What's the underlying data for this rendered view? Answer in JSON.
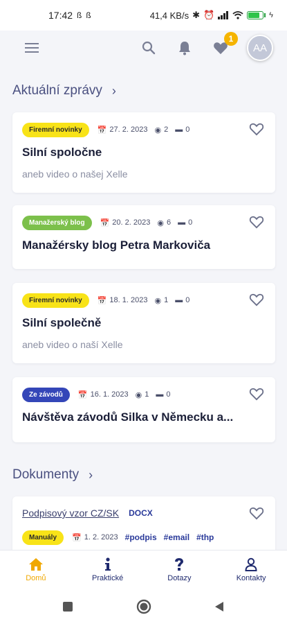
{
  "status_bar": {
    "time": "17:42",
    "left_icons": [
      "sync-icon",
      "sync-icon"
    ],
    "net_speed": "41,4 KB/s",
    "battery_percent": 80
  },
  "header": {
    "favorites_count": "1",
    "avatar_initials": "AA"
  },
  "news": {
    "title": "Aktuální zprávy",
    "items": [
      {
        "tag": "Firemní novinky",
        "tag_color": "#f8e318",
        "date": "27. 2. 2023",
        "views": "2",
        "comments": "0",
        "title": "Silní spoločne",
        "subtitle": "aneb video o našej Xelle"
      },
      {
        "tag": "Manažerský blog",
        "tag_color": "#7cc04b",
        "date": "20. 2. 2023",
        "views": "6",
        "comments": "0",
        "title": "Manažérsky blog Petra Markoviča",
        "subtitle": ""
      },
      {
        "tag": "Firemní novinky",
        "tag_color": "#f8e318",
        "date": "18. 1. 2023",
        "views": "1",
        "comments": "0",
        "title": "Silní společně",
        "subtitle": "aneb video o naší Xelle"
      },
      {
        "tag": "Ze závodů",
        "tag_color": "#3446b8",
        "date": "16. 1. 2023",
        "views": "1",
        "comments": "0",
        "title": "Návštěva závodů Silka v Německu a...",
        "subtitle": ""
      }
    ]
  },
  "documents": {
    "title": "Dokumenty",
    "items": [
      {
        "title": "Podpisový vzor CZ/SK",
        "ext": "DOCX",
        "tag": "Manuály",
        "date": "1. 2. 2023",
        "hashtags": [
          "#podpis",
          "#email",
          "#thp"
        ]
      }
    ]
  },
  "bottom_nav": [
    {
      "label": "Domů",
      "icon": "home-icon",
      "active": true
    },
    {
      "label": "Praktické",
      "icon": "info-icon",
      "active": false
    },
    {
      "label": "Dotazy",
      "icon": "question-icon",
      "active": false
    },
    {
      "label": "Kontakty",
      "icon": "contact-icon",
      "active": false
    }
  ],
  "colors": {
    "accent": "#f5b400",
    "primary": "#1f2a6e",
    "link": "#2a3a9a"
  }
}
